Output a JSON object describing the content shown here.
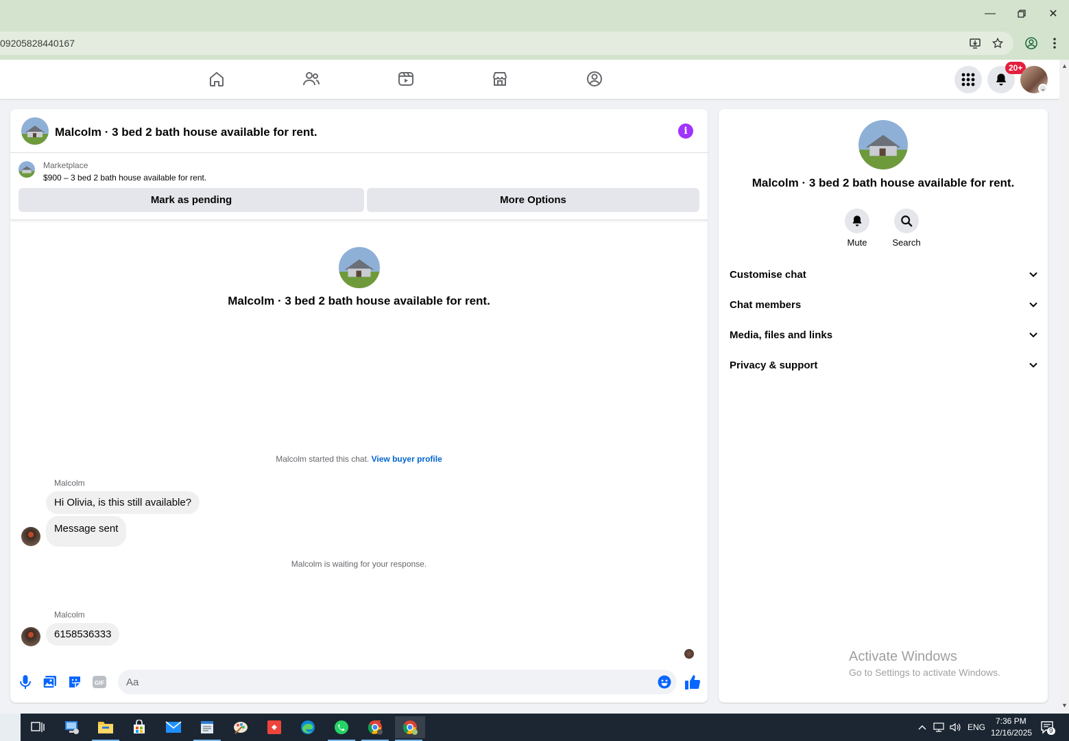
{
  "browser": {
    "url": "09205828440167"
  },
  "nav": {
    "notification_count": "20+"
  },
  "chat": {
    "title": "Malcolm · 3 bed 2 bath house available for rent.",
    "listing": {
      "source_label": "Marketplace",
      "price_line": "$900 – 3 bed 2 bath house available for rent."
    },
    "buttons": {
      "mark_pending": "Mark as pending",
      "more_options": "More Options"
    },
    "center_title": "Malcolm · 3 bed 2 bath house available for rent.",
    "started_text": "Malcolm started this chat.",
    "view_profile": "View buyer profile",
    "messages": [
      {
        "sender": "Malcolm",
        "text": "Hi Olivia, is this still available?"
      },
      {
        "text": "Message sent"
      },
      {
        "sender": "Malcolm",
        "text": "6158536333"
      }
    ],
    "waiting_text": "Malcolm is waiting for your response.",
    "composer_placeholder": "Aa"
  },
  "info_panel": {
    "title": "Malcolm · 3 bed 2 bath house available for rent.",
    "actions": {
      "mute": "Mute",
      "search": "Search"
    },
    "sections": [
      "Customise chat",
      "Chat members",
      "Media, files and links",
      "Privacy & support"
    ],
    "watermark_title": "Activate Windows",
    "watermark_sub": "Go to Settings to activate Windows."
  },
  "taskbar": {
    "language": "ENG",
    "time": "7:36 PM",
    "date": "12/16/2025",
    "notification_count": "9"
  },
  "colors": {
    "accent_blue": "#0866ff",
    "info_purple": "#a033ff",
    "badge_red": "#e41e3f"
  }
}
